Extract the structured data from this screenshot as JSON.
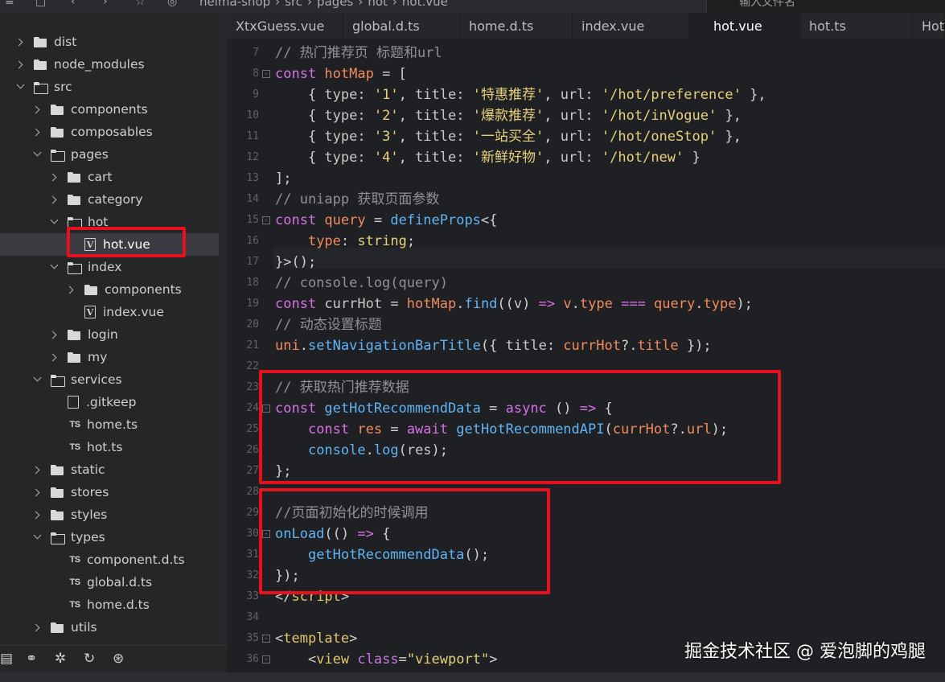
{
  "toolbar": {
    "breadcrumb": [
      "heima-shop",
      "src",
      "pages",
      "hot",
      "hot.vue"
    ],
    "search_placeholder": "输入文件名"
  },
  "sidebar": {
    "items": [
      {
        "label": "dist",
        "kind": "folder",
        "depth": 0,
        "state": "collapsed"
      },
      {
        "label": "node_modules",
        "kind": "folder",
        "depth": 0,
        "state": "collapsed"
      },
      {
        "label": "src",
        "kind": "folder",
        "depth": 0,
        "state": "expanded"
      },
      {
        "label": "components",
        "kind": "folder",
        "depth": 1,
        "state": "collapsed"
      },
      {
        "label": "composables",
        "kind": "folder",
        "depth": 1,
        "state": "collapsed"
      },
      {
        "label": "pages",
        "kind": "folder",
        "depth": 1,
        "state": "expanded"
      },
      {
        "label": "cart",
        "kind": "folder",
        "depth": 2,
        "state": "collapsed"
      },
      {
        "label": "category",
        "kind": "folder",
        "depth": 2,
        "state": "collapsed"
      },
      {
        "label": "hot",
        "kind": "folder",
        "depth": 2,
        "state": "expanded"
      },
      {
        "label": "hot.vue",
        "kind": "vue",
        "depth": 3,
        "state": "selected"
      },
      {
        "label": "index",
        "kind": "folder",
        "depth": 2,
        "state": "expanded"
      },
      {
        "label": "components",
        "kind": "folder",
        "depth": 3,
        "state": "collapsed"
      },
      {
        "label": "index.vue",
        "kind": "vue",
        "depth": 3,
        "state": "file"
      },
      {
        "label": "login",
        "kind": "folder",
        "depth": 2,
        "state": "collapsed"
      },
      {
        "label": "my",
        "kind": "folder",
        "depth": 2,
        "state": "collapsed"
      },
      {
        "label": "services",
        "kind": "folder",
        "depth": 1,
        "state": "expanded"
      },
      {
        "label": ".gitkeep",
        "kind": "blank",
        "depth": 2,
        "state": "file"
      },
      {
        "label": "home.ts",
        "kind": "ts",
        "depth": 2,
        "state": "file"
      },
      {
        "label": "hot.ts",
        "kind": "ts",
        "depth": 2,
        "state": "file"
      },
      {
        "label": "static",
        "kind": "folder",
        "depth": 1,
        "state": "collapsed"
      },
      {
        "label": "stores",
        "kind": "folder",
        "depth": 1,
        "state": "collapsed"
      },
      {
        "label": "styles",
        "kind": "folder",
        "depth": 1,
        "state": "collapsed"
      },
      {
        "label": "types",
        "kind": "folder",
        "depth": 1,
        "state": "expanded"
      },
      {
        "label": "component.d.ts",
        "kind": "ts",
        "depth": 2,
        "state": "file"
      },
      {
        "label": "global.d.ts",
        "kind": "ts",
        "depth": 2,
        "state": "file"
      },
      {
        "label": "home.d.ts",
        "kind": "ts",
        "depth": 2,
        "state": "file"
      },
      {
        "label": "utils",
        "kind": "folder",
        "depth": 1,
        "state": "collapsed"
      }
    ],
    "bottom_icons": [
      "explorer-icon",
      "binoculars-icon",
      "bug-icon",
      "source-control-icon",
      "plugin-icon"
    ]
  },
  "tabs": [
    {
      "label": "XtxGuess.vue",
      "active": false
    },
    {
      "label": "global.d.ts",
      "active": false
    },
    {
      "label": "home.d.ts",
      "active": false
    },
    {
      "label": "index.vue",
      "active": false
    },
    {
      "label": "hot.vue",
      "active": true
    },
    {
      "label": "hot.ts",
      "active": false
    },
    {
      "label": "Hot",
      "active": false
    }
  ],
  "editor": {
    "lines": [
      {
        "n": "7",
        "fold": "",
        "tokens": [
          [
            "c-comment",
            "// 热门推荐页 标题和url"
          ]
        ]
      },
      {
        "n": "8",
        "fold": "-",
        "tokens": [
          [
            "c-kw",
            "const "
          ],
          [
            "c-var",
            "hotMap"
          ],
          [
            "c-punc",
            " = ["
          ]
        ]
      },
      {
        "n": "9",
        "fold": "",
        "tokens": [
          [
            "c-punc",
            "    { "
          ],
          [
            "c-prop",
            "type"
          ],
          [
            "c-punc",
            ": "
          ],
          [
            "c-str",
            "'1'"
          ],
          [
            "c-punc",
            ", "
          ],
          [
            "c-prop",
            "title"
          ],
          [
            "c-punc",
            ": "
          ],
          [
            "c-str",
            "'特惠推荐'"
          ],
          [
            "c-punc",
            ", "
          ],
          [
            "c-prop",
            "url"
          ],
          [
            "c-punc",
            ": "
          ],
          [
            "c-str",
            "'/hot/preference'"
          ],
          [
            "c-punc",
            " },"
          ]
        ]
      },
      {
        "n": "10",
        "fold": "",
        "tokens": [
          [
            "c-punc",
            "    { "
          ],
          [
            "c-prop",
            "type"
          ],
          [
            "c-punc",
            ": "
          ],
          [
            "c-str",
            "'2'"
          ],
          [
            "c-punc",
            ", "
          ],
          [
            "c-prop",
            "title"
          ],
          [
            "c-punc",
            ": "
          ],
          [
            "c-str",
            "'爆款推荐'"
          ],
          [
            "c-punc",
            ", "
          ],
          [
            "c-prop",
            "url"
          ],
          [
            "c-punc",
            ": "
          ],
          [
            "c-str",
            "'/hot/inVogue'"
          ],
          [
            "c-punc",
            " },"
          ]
        ]
      },
      {
        "n": "11",
        "fold": "",
        "tokens": [
          [
            "c-punc",
            "    { "
          ],
          [
            "c-prop",
            "type"
          ],
          [
            "c-punc",
            ": "
          ],
          [
            "c-str",
            "'3'"
          ],
          [
            "c-punc",
            ", "
          ],
          [
            "c-prop",
            "title"
          ],
          [
            "c-punc",
            ": "
          ],
          [
            "c-str",
            "'一站买全'"
          ],
          [
            "c-punc",
            ", "
          ],
          [
            "c-prop",
            "url"
          ],
          [
            "c-punc",
            ": "
          ],
          [
            "c-str",
            "'/hot/oneStop'"
          ],
          [
            "c-punc",
            " },"
          ]
        ]
      },
      {
        "n": "12",
        "fold": "",
        "tokens": [
          [
            "c-punc",
            "    { "
          ],
          [
            "c-prop",
            "type"
          ],
          [
            "c-punc",
            ": "
          ],
          [
            "c-str",
            "'4'"
          ],
          [
            "c-punc",
            ", "
          ],
          [
            "c-prop",
            "title"
          ],
          [
            "c-punc",
            ": "
          ],
          [
            "c-str",
            "'新鲜好物'"
          ],
          [
            "c-punc",
            ", "
          ],
          [
            "c-prop",
            "url"
          ],
          [
            "c-punc",
            ": "
          ],
          [
            "c-str",
            "'/hot/new'"
          ],
          [
            "c-punc",
            " }"
          ]
        ]
      },
      {
        "n": "13",
        "fold": "",
        "tokens": [
          [
            "c-punc",
            "];"
          ]
        ]
      },
      {
        "n": "14",
        "fold": "",
        "tokens": [
          [
            "c-comment",
            "// uniapp 获取页面参数"
          ]
        ]
      },
      {
        "n": "15",
        "fold": "-",
        "tokens": [
          [
            "c-kw",
            "const "
          ],
          [
            "c-var",
            "query"
          ],
          [
            "c-punc",
            " = "
          ],
          [
            "c-fn",
            "defineProps"
          ],
          [
            "c-punc",
            "<{"
          ]
        ]
      },
      {
        "n": "16",
        "fold": "",
        "tokens": [
          [
            "c-punc",
            "    "
          ],
          [
            "c-var",
            "type"
          ],
          [
            "c-punc",
            ": "
          ],
          [
            "c-type",
            "string"
          ],
          [
            "c-punc",
            ";"
          ]
        ]
      },
      {
        "n": "17",
        "fold": "",
        "tokens": [
          [
            "c-punc",
            "}>();"
          ]
        ]
      },
      {
        "n": "18",
        "fold": "",
        "tokens": [
          [
            "c-comment",
            "// console.log(query)"
          ]
        ]
      },
      {
        "n": "19",
        "fold": "",
        "tokens": [
          [
            "c-kw",
            "const "
          ],
          [
            "c-prop",
            "currHot"
          ],
          [
            "c-punc",
            " = "
          ],
          [
            "c-var",
            "hotMap"
          ],
          [
            "c-punc",
            "."
          ],
          [
            "c-fn",
            "find"
          ],
          [
            "c-punc",
            "(("
          ],
          [
            "c-prop",
            "v"
          ],
          [
            "c-punc",
            ") "
          ],
          [
            "c-kw",
            "=>"
          ],
          [
            "c-punc",
            " "
          ],
          [
            "c-var",
            "v"
          ],
          [
            "c-punc",
            "."
          ],
          [
            "c-var",
            "type"
          ],
          [
            "c-punc",
            " "
          ],
          [
            "c-kw",
            "==="
          ],
          [
            "c-punc",
            " "
          ],
          [
            "c-var",
            "query"
          ],
          [
            "c-punc",
            "."
          ],
          [
            "c-var",
            "type"
          ],
          [
            "c-punc",
            ");"
          ]
        ]
      },
      {
        "n": "20",
        "fold": "",
        "tokens": [
          [
            "c-comment",
            "// 动态设置标题"
          ]
        ]
      },
      {
        "n": "21",
        "fold": "",
        "tokens": [
          [
            "c-var",
            "uni"
          ],
          [
            "c-punc",
            "."
          ],
          [
            "c-fn",
            "setNavigationBarTitle"
          ],
          [
            "c-punc",
            "({ "
          ],
          [
            "c-prop",
            "title"
          ],
          [
            "c-punc",
            ": "
          ],
          [
            "c-var",
            "currHot"
          ],
          [
            "c-punc",
            "?."
          ],
          [
            "c-var",
            "title"
          ],
          [
            "c-punc",
            " });"
          ]
        ]
      },
      {
        "n": "22",
        "fold": "",
        "tokens": []
      },
      {
        "n": "23",
        "fold": "",
        "tokens": [
          [
            "c-comment",
            "// 获取热门推荐数据"
          ]
        ]
      },
      {
        "n": "24",
        "fold": "-",
        "tokens": [
          [
            "c-kw",
            "const "
          ],
          [
            "c-fn",
            "getHotRecommendData"
          ],
          [
            "c-punc",
            " = "
          ],
          [
            "c-kw",
            "async"
          ],
          [
            "c-punc",
            " () "
          ],
          [
            "c-kw",
            "=>"
          ],
          [
            "c-punc",
            " {"
          ]
        ]
      },
      {
        "n": "25",
        "fold": "",
        "tokens": [
          [
            "c-punc",
            "    "
          ],
          [
            "c-kw",
            "const "
          ],
          [
            "c-var",
            "res"
          ],
          [
            "c-punc",
            " = "
          ],
          [
            "c-kw",
            "await"
          ],
          [
            "c-punc",
            " "
          ],
          [
            "c-fn",
            "getHotRecommendAPI"
          ],
          [
            "c-punc",
            "("
          ],
          [
            "c-var",
            "currHot"
          ],
          [
            "c-punc",
            "?."
          ],
          [
            "c-var",
            "url"
          ],
          [
            "c-punc",
            ");"
          ]
        ]
      },
      {
        "n": "26",
        "fold": "",
        "tokens": [
          [
            "c-punc",
            "    "
          ],
          [
            "c-fn",
            "console"
          ],
          [
            "c-punc",
            "."
          ],
          [
            "c-fn",
            "log"
          ],
          [
            "c-punc",
            "("
          ],
          [
            "c-prop",
            "res"
          ],
          [
            "c-punc",
            ");"
          ]
        ]
      },
      {
        "n": "27",
        "fold": "",
        "tokens": [
          [
            "c-punc",
            "};"
          ]
        ]
      },
      {
        "n": "28",
        "fold": "",
        "tokens": []
      },
      {
        "n": "29",
        "fold": "",
        "tokens": [
          [
            "c-comment",
            "//页面初始化的时候调用"
          ]
        ]
      },
      {
        "n": "30",
        "fold": "-",
        "tokens": [
          [
            "c-fn",
            "onLoad"
          ],
          [
            "c-punc",
            "(() "
          ],
          [
            "c-kw",
            "=>"
          ],
          [
            "c-punc",
            " {"
          ]
        ]
      },
      {
        "n": "31",
        "fold": "",
        "tokens": [
          [
            "c-punc",
            "    "
          ],
          [
            "c-fn",
            "getHotRecommendData"
          ],
          [
            "c-punc",
            "();"
          ]
        ]
      },
      {
        "n": "32",
        "fold": "",
        "tokens": [
          [
            "c-punc",
            "});"
          ]
        ]
      },
      {
        "n": "33",
        "fold": "",
        "tokens": [
          [
            "c-punc",
            "</"
          ],
          [
            "c-tag",
            "script"
          ],
          [
            "c-punc",
            ">"
          ]
        ]
      },
      {
        "n": "34",
        "fold": "",
        "tokens": []
      },
      {
        "n": "35",
        "fold": "-",
        "tokens": [
          [
            "c-punc",
            "<"
          ],
          [
            "c-tag",
            "template"
          ],
          [
            "c-punc",
            ">"
          ]
        ]
      },
      {
        "n": "36",
        "fold": "-",
        "tokens": [
          [
            "c-punc",
            "    <"
          ],
          [
            "c-tag",
            "view"
          ],
          [
            "c-punc",
            " "
          ],
          [
            "c-attr",
            "class"
          ],
          [
            "c-punc",
            "="
          ],
          [
            "c-str",
            "\"viewport\""
          ],
          [
            "c-punc",
            ">"
          ]
        ]
      }
    ]
  },
  "watermark": "掘金技术社区 @ 爱泡脚的鸡腿",
  "colors": {
    "highlight_box": "#e5121d",
    "keyword": "#d571e6",
    "variable": "#f18b5d",
    "function": "#5fb4f5",
    "string": "#e6d17a",
    "comment": "#8f9196"
  }
}
